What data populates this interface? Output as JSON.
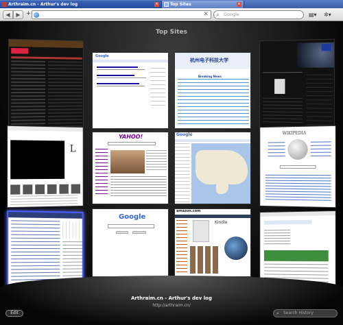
{
  "tabs": [
    {
      "label": "Arthraim.cn - Arthur's dev log",
      "active": false
    },
    {
      "label": "Top Sites",
      "active": true
    }
  ],
  "toolbar": {
    "address_value": "",
    "search_placeholder": "Google",
    "back_glyph": "◀",
    "forward_glyph": "▶",
    "add_glyph": "+",
    "stop_glyph": "✕",
    "page_menu_glyph": "▤▾",
    "settings_glyph": "✲▾"
  },
  "top_sites": {
    "title": "Top Sites",
    "thumbnails": [
      {
        "site": "dark-forum",
        "row": 1,
        "col": 1
      },
      {
        "site": "google-results",
        "row": 1,
        "col": 2
      },
      {
        "site": "university-news",
        "row": 1,
        "col": 3
      },
      {
        "site": "dark-blog",
        "row": 1,
        "col": 4
      },
      {
        "site": "video-page",
        "row": 2,
        "col": 1
      },
      {
        "site": "yahoo",
        "row": 2,
        "col": 2
      },
      {
        "site": "google-maps",
        "row": 2,
        "col": 3
      },
      {
        "site": "wikipedia",
        "row": 2,
        "col": 4
      },
      {
        "site": "arthraim-blog",
        "row": 3,
        "col": 1,
        "selected": true
      },
      {
        "site": "google-home",
        "row": 3,
        "col": 2
      },
      {
        "site": "amazon",
        "row": 3,
        "col": 3
      },
      {
        "site": "profile-page",
        "row": 3,
        "col": 4
      }
    ],
    "selected_caption": {
      "title": "Arthraim.cn - Arthur's dev log",
      "url": "http://arthraim.cn/"
    },
    "edit_label": "Edit",
    "search_history_placeholder": "Search History"
  },
  "thumbnail_text": {
    "yahoo_logo": "YAHOO!",
    "google_logo": "Google",
    "google_small": "Google",
    "wikipedia_logo": "WIKIPEDIA",
    "amazon_logo": "amazon.com",
    "kindle": "Kindle",
    "university_logo": "杭州电子科技大学",
    "news_heading": "Breaking News",
    "video_logo": "L"
  },
  "colors": {
    "tab_active": "#8aa6dc",
    "tab_inactive": "#23479a",
    "selection_outline": "#4a5dff",
    "stage_background": "#000000"
  }
}
